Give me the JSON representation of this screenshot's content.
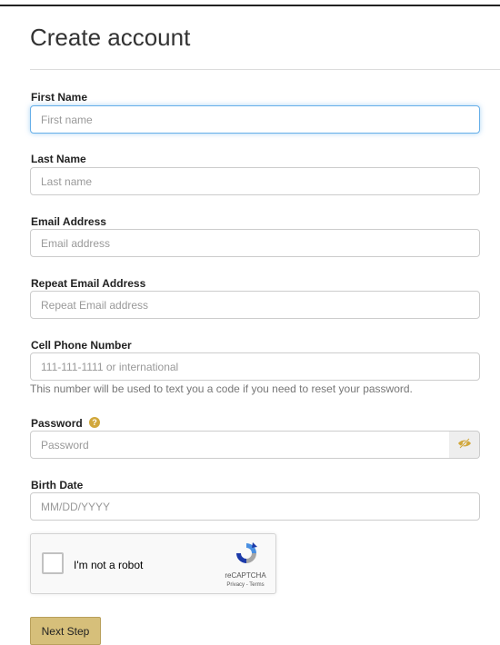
{
  "page": {
    "title": "Create account"
  },
  "form": {
    "first_name": {
      "label": "First Name",
      "placeholder": "First name"
    },
    "last_name": {
      "label": "Last Name",
      "placeholder": "Last name"
    },
    "email": {
      "label": "Email Address",
      "placeholder": "Email address"
    },
    "repeat_email": {
      "label": "Repeat Email Address",
      "placeholder": "Repeat Email address"
    },
    "phone": {
      "label": "Cell Phone Number",
      "placeholder": "111-111-1111 or international",
      "help": "This number will be used to text you a code if you need to reset your password."
    },
    "password": {
      "label": "Password",
      "placeholder": "Password",
      "help_icon": "question-circle-icon",
      "toggle_icon": "eye-slash-icon"
    },
    "birth_date": {
      "label": "Birth Date",
      "placeholder": "MM/DD/YYYY"
    }
  },
  "recaptcha": {
    "label": "I'm not a robot",
    "brand": "reCAPTCHA",
    "links": "Privacy - Terms"
  },
  "actions": {
    "next_label": "Next Step"
  },
  "colors": {
    "accent": "#d6bf7a",
    "help_icon": "#d1a73b",
    "focus": "#66afe9"
  }
}
